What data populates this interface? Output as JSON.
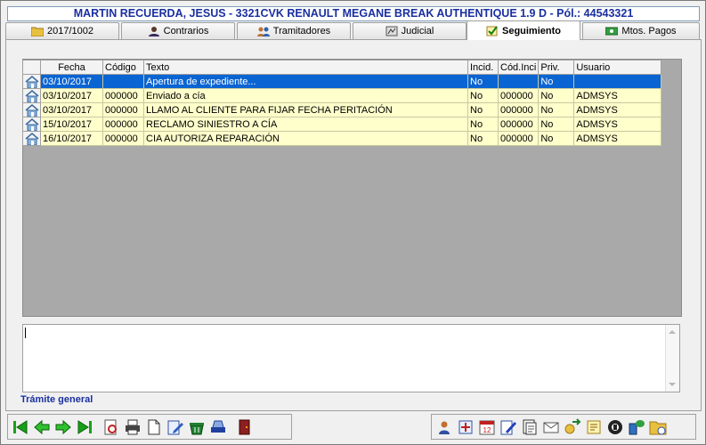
{
  "header": {
    "title": "MARTIN RECUERDA, JESUS - 3321CVK RENAULT MEGANE BREAK AUTHENTIQUE 1.9 D - Pól.: 44543321"
  },
  "tabs": [
    {
      "label": "2017/1002",
      "icon": "folder-icon"
    },
    {
      "label": "Contrarios",
      "icon": "person-icon"
    },
    {
      "label": "Tramitadores",
      "icon": "users-icon"
    },
    {
      "label": "Judicial",
      "icon": "court-icon"
    },
    {
      "label": "Seguimiento",
      "icon": "checklist-icon",
      "active": true
    },
    {
      "label": "Mtos. Pagos",
      "icon": "money-icon"
    }
  ],
  "grid": {
    "columns": [
      "Fecha",
      "Código",
      "Texto",
      "Incid.",
      "Cód.Inci",
      "Priv.",
      "Usuario"
    ],
    "rows": [
      [
        "03/10/2017",
        "",
        "Apertura de expediente...",
        "No",
        "",
        "No",
        ""
      ],
      [
        "03/10/2017",
        "000000",
        "Enviado a cía",
        "No",
        "000000",
        "No",
        "ADMSYS"
      ],
      [
        "03/10/2017",
        "000000",
        "LLAMO AL CLIENTE PARA FIJAR FECHA PERITACIÓN",
        "No",
        "000000",
        "No",
        "ADMSYS"
      ],
      [
        "15/10/2017",
        "000000",
        "RECLAMO SINIESTRO A CÍA",
        "No",
        "000000",
        "No",
        "ADMSYS"
      ],
      [
        "16/10/2017",
        "000000",
        "CIA AUTORIZA REPARACIÓN",
        "No",
        "000000",
        "No",
        "ADMSYS"
      ]
    ],
    "selected_row": 0
  },
  "memo": {
    "value": ""
  },
  "status": {
    "label": "Trámite general"
  },
  "toolbar_left": [
    "first-record-icon",
    "previous-record-icon",
    "next-record-icon",
    "last-record-icon",
    "search-document-icon",
    "print-icon",
    "new-document-icon",
    "edit-icon",
    "delete-icon",
    "scanner-icon",
    "exit-icon"
  ],
  "toolbar_right": [
    "user-icon",
    "settings-icon",
    "calendar-icon",
    "write-icon",
    "documents-icon",
    "email-icon",
    "money-transfer-icon",
    "notes-icon",
    "phone-icon",
    "sms-icon",
    "folder-clock-icon"
  ],
  "colors": {
    "title_text": "#1a2fa0",
    "selected_row": "#0a64d2",
    "row_bg": "#ffffcc",
    "grid_bg": "#a9a9a9"
  }
}
